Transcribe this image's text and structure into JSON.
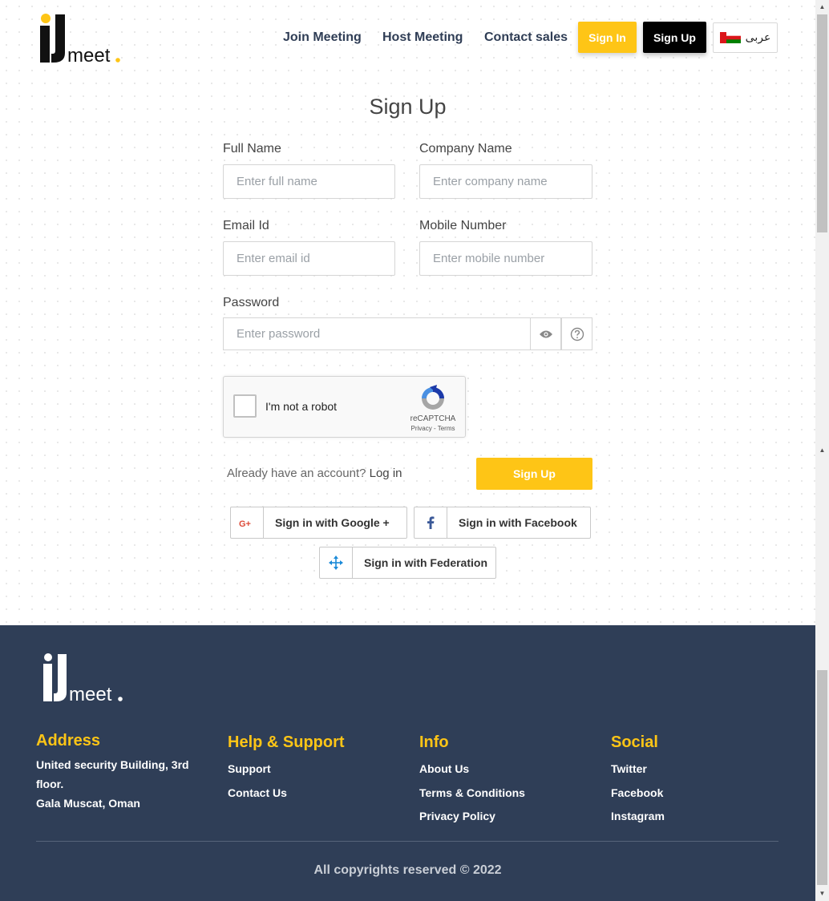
{
  "header": {
    "logo_alt": "IJmeet",
    "nav": [
      {
        "label": "Join Meeting"
      },
      {
        "label": "Host Meeting"
      },
      {
        "label": "Contact sales"
      }
    ],
    "signin_label": "Sign In",
    "signup_label": "Sign Up",
    "language_label": "عربى"
  },
  "form": {
    "title": "Sign Up",
    "full_name": {
      "label": "Full Name",
      "placeholder": "Enter full name",
      "value": ""
    },
    "company_name": {
      "label": "Company Name",
      "placeholder": "Enter company name",
      "value": ""
    },
    "email": {
      "label": "Email Id",
      "placeholder": "Enter email id",
      "value": ""
    },
    "mobile": {
      "label": "Mobile Number",
      "placeholder": "Enter mobile number",
      "value": ""
    },
    "password": {
      "label": "Password",
      "placeholder": "Enter password",
      "value": ""
    },
    "captcha": {
      "label": "I'm not a robot",
      "brand": "reCAPTCHA",
      "privacy": "Privacy",
      "separator": " - ",
      "terms": "Terms"
    },
    "already_text": "Already have an account?",
    "login_link": "Log in",
    "submit_label": "Sign Up",
    "social": {
      "google": "Sign in with Google +",
      "facebook": "Sign in with Facebook",
      "federation": "Sign in with Federation"
    }
  },
  "footer": {
    "logo_alt": "IJmeet",
    "address": {
      "title": "Address",
      "line1": "United security Building, 3rd floor.",
      "line2": "Gala Muscat, Oman"
    },
    "help": {
      "title": "Help & Support",
      "links": [
        "Support",
        "Contact Us"
      ]
    },
    "info": {
      "title": "Info",
      "links": [
        "About Us",
        "Terms & Conditions",
        "Privacy Policy"
      ]
    },
    "social": {
      "title": "Social",
      "links": [
        "Twitter",
        "Facebook",
        "Instagram"
      ]
    },
    "copyright": "All copyrights reserved © 2022"
  },
  "colors": {
    "accent": "#fec516",
    "footer_bg": "#2f3e57",
    "nav_text": "#2f3d55",
    "black_button": "#000000"
  },
  "icons": {
    "eye": "eye-icon",
    "help": "question-circle-icon",
    "google": "google-plus-icon",
    "facebook": "facebook-icon",
    "federation": "federation-icon",
    "flag": "oman-flag-icon"
  }
}
